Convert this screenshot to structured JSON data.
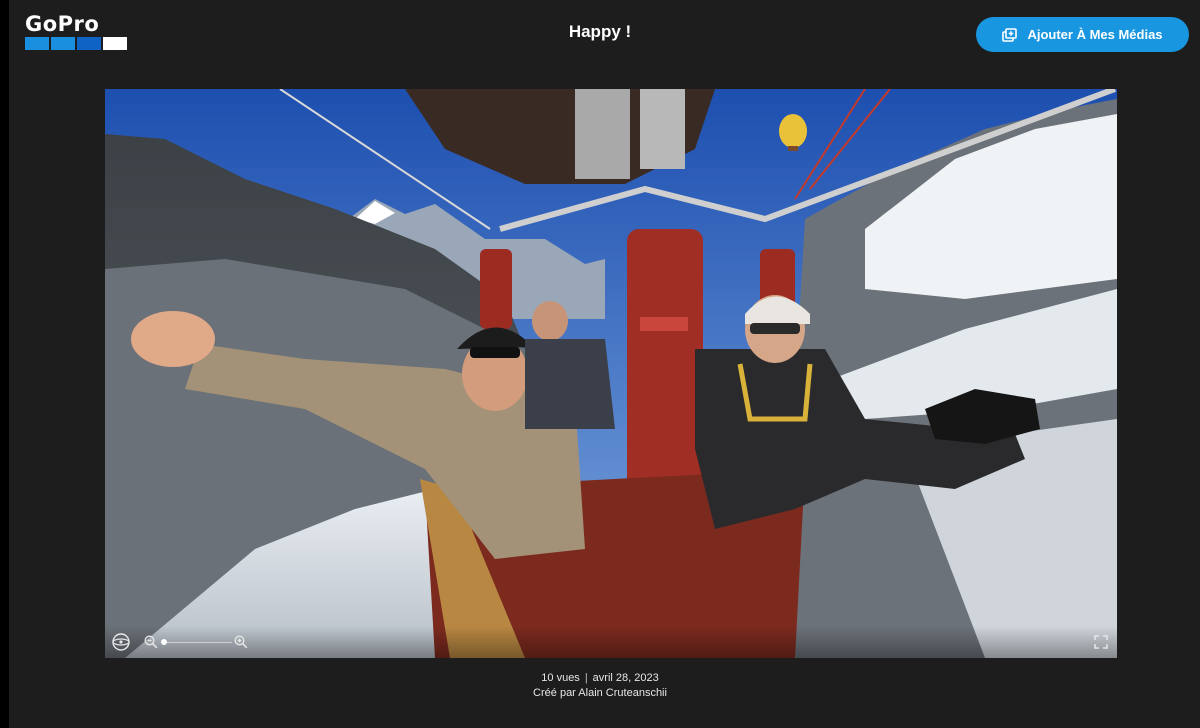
{
  "header": {
    "logo_text": "GoPro",
    "title": "Happy !",
    "add_button_label": "Ajouter À Mes Médias"
  },
  "brand_colors": {
    "logo_squares": [
      "#1a8fe0",
      "#1a8fe0",
      "#0f63c4",
      "#ffffff"
    ],
    "button": "#1996e0",
    "background": "#1d1d1d"
  },
  "icons": {
    "add_media": "add-media-icon",
    "view_mode": "view-mode-icon",
    "zoom_out": "zoom-out-icon",
    "zoom_in": "zoom-in-icon",
    "fullscreen": "fullscreen-icon"
  },
  "viewer": {
    "zoom_level": 0.0
  },
  "meta": {
    "views": "10 vues",
    "separator": "|",
    "date": "avril 28, 2023",
    "creator": "Créé par Alain Cruteanschii"
  }
}
